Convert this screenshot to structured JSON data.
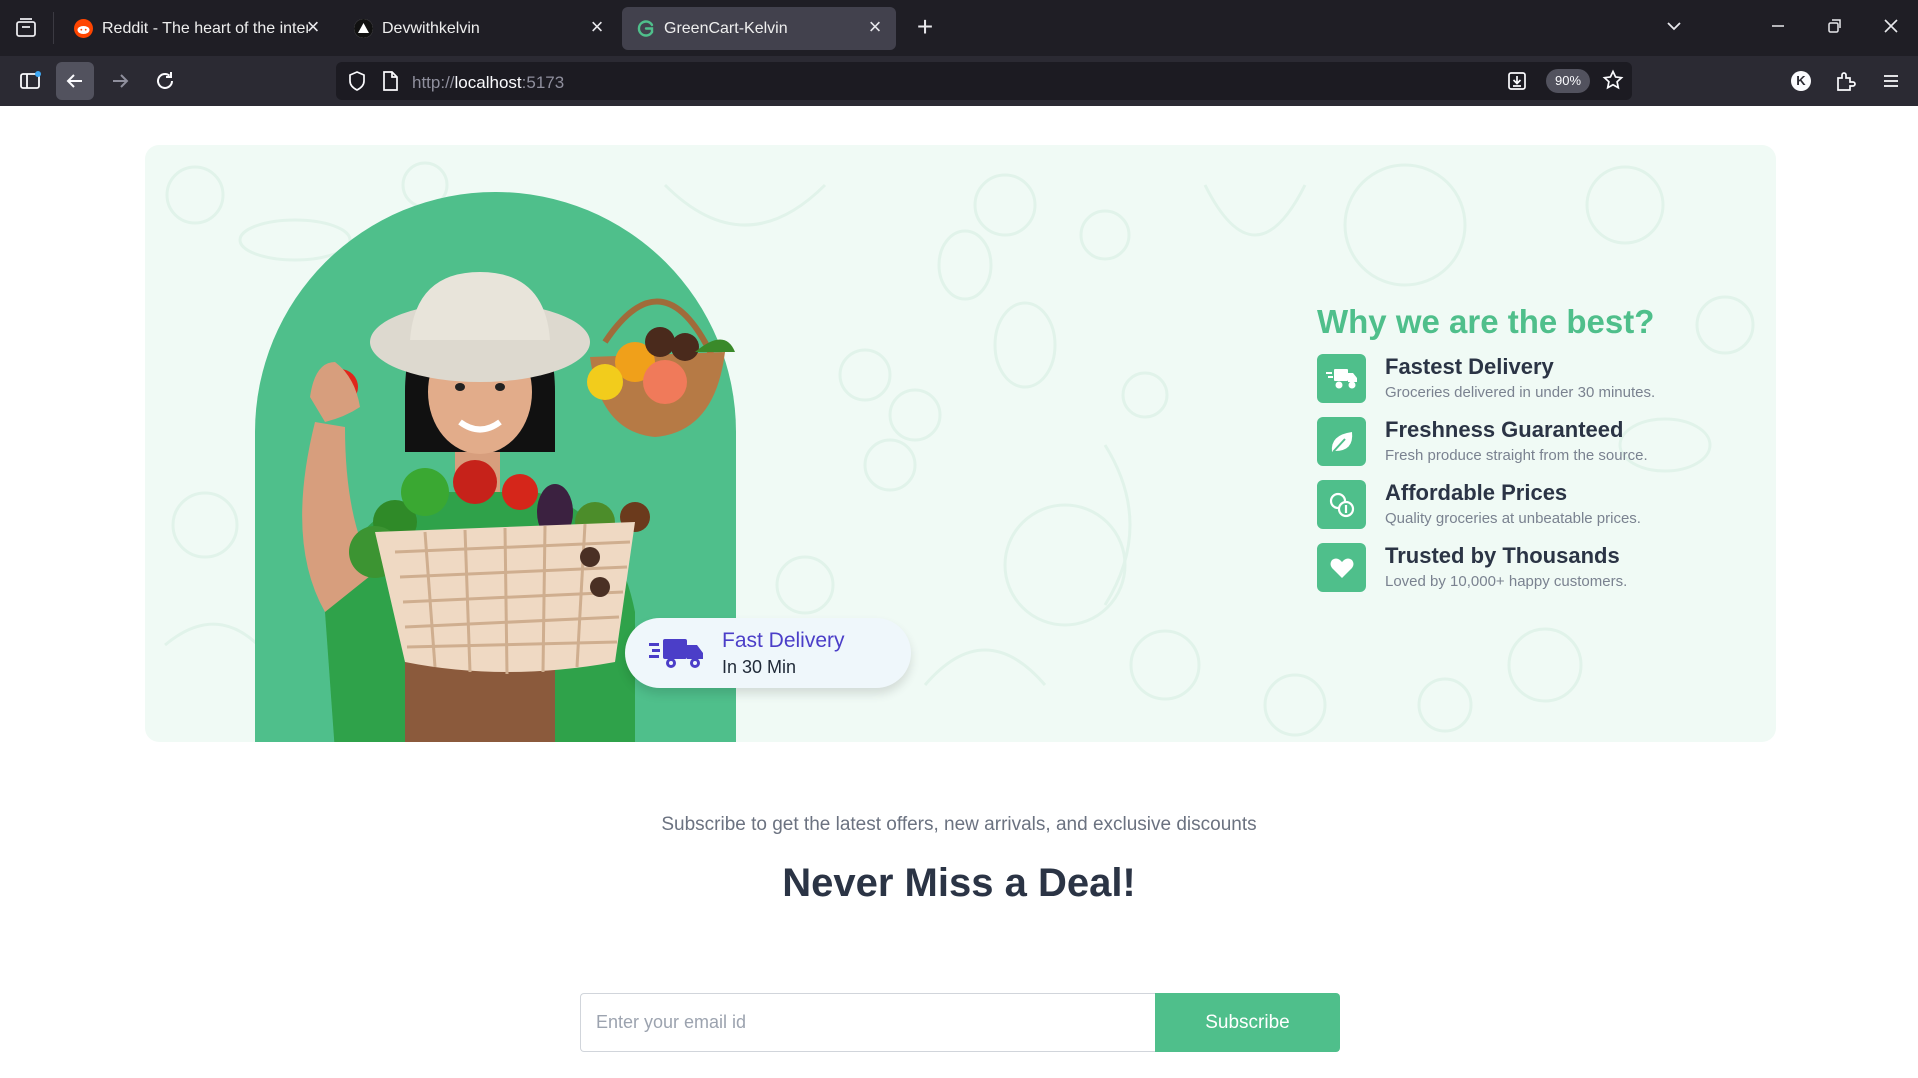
{
  "browser": {
    "tabs": [
      {
        "title": "Reddit - The heart of the interne",
        "favicon": "reddit-icon",
        "active": false
      },
      {
        "title": "Devwithkelvin",
        "favicon": "triangle-icon",
        "active": false
      },
      {
        "title": "GreenCart-Kelvin",
        "favicon": "greencart-icon",
        "active": true
      }
    ],
    "url_scheme": "http://",
    "url_host": "localhost",
    "url_rest": ":5173",
    "zoom": "90%",
    "profile_initial": "K"
  },
  "hero": {
    "badge": {
      "title": "Fast Delivery",
      "subtitle": "In 30 Min"
    },
    "why_title": "Why we are the best?",
    "features": [
      {
        "title": "Fastest Delivery",
        "desc": "Groceries delivered in under 30 minutes.",
        "icon": "delivery-truck-icon"
      },
      {
        "title": "Freshness Guaranteed",
        "desc": "Fresh produce straight from the source.",
        "icon": "leaf-icon"
      },
      {
        "title": "Affordable Prices",
        "desc": "Quality groceries at unbeatable prices.",
        "icon": "coins-icon"
      },
      {
        "title": "Trusted by Thousands",
        "desc": "Loved by 10,000+ happy customers.",
        "icon": "heart-hand-icon"
      }
    ]
  },
  "newsletter": {
    "title": "Never Miss a Deal!",
    "subtitle": "Subscribe to get the latest offers, new arrivals, and exclusive discounts",
    "placeholder": "Enter your email id",
    "button": "Subscribe"
  },
  "colors": {
    "brand": "#4fbf8b",
    "badge_text": "#4b3ec8",
    "heading": "#2b3445"
  }
}
